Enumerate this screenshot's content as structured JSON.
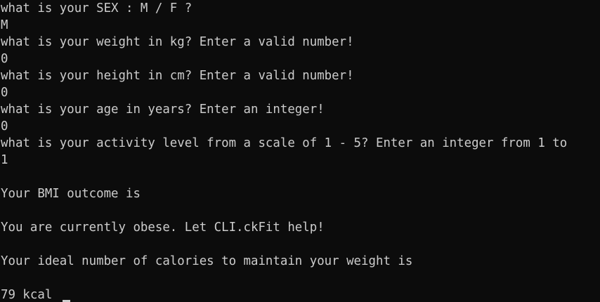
{
  "console": {
    "lines": [
      "what is your SEX : M / F ?",
      "M",
      "what is your weight in kg? Enter a valid number!",
      "0",
      "what is your height in cm? Enter a valid number!",
      "0",
      "what is your age in years? Enter an integer!",
      "0",
      "what is your activity level from a scale of 1 - 5? Enter an integer from 1 to",
      "1",
      "",
      "Your BMI outcome is",
      "",
      "You are currently obese. Let CLI.ckFit help!",
      "",
      "Your ideal number of calories to maintain your weight is",
      "",
      "79 kcal"
    ]
  },
  "colors": {
    "background": "#0c0c0c",
    "text": "#cccccc"
  }
}
